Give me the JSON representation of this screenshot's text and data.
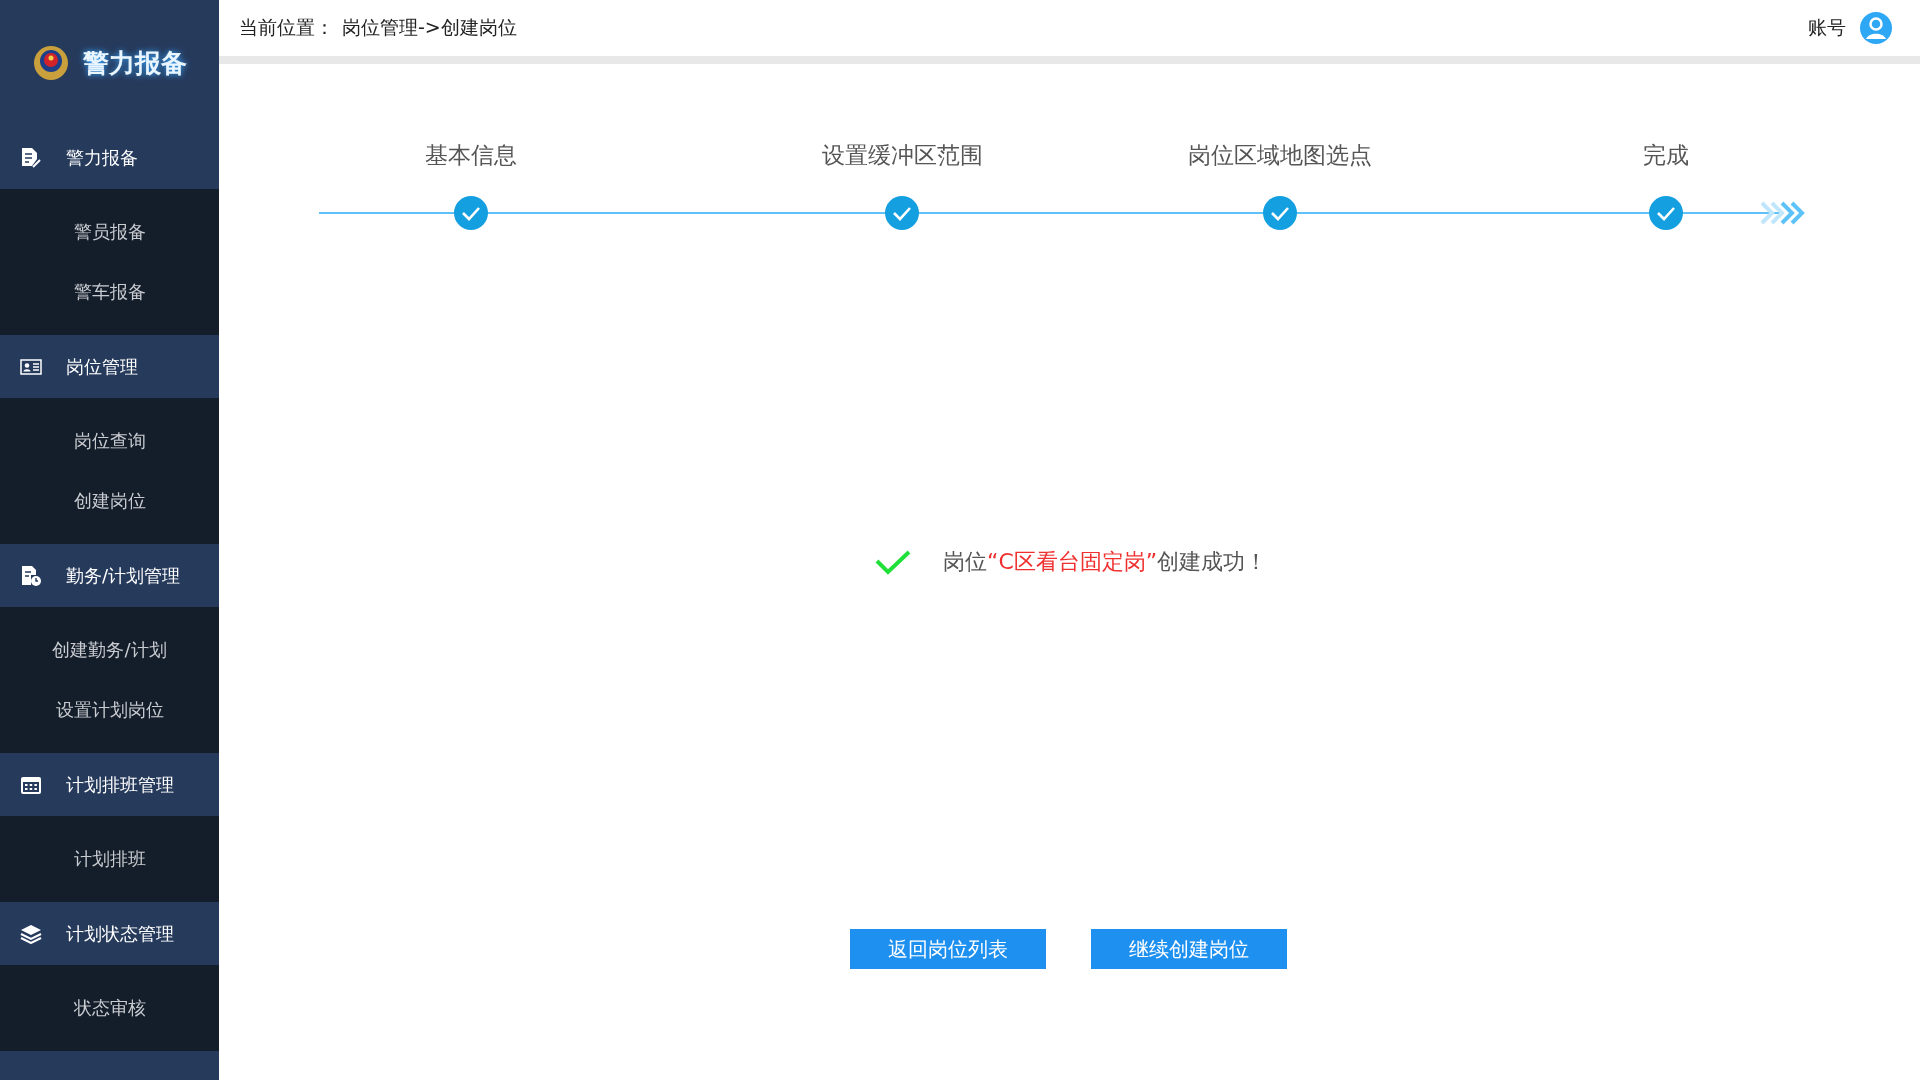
{
  "sidebar": {
    "logo_text": "警力报备",
    "groups": [
      {
        "label": "警力报备",
        "items": [
          "警员报备",
          "警车报备"
        ]
      },
      {
        "label": "岗位管理",
        "items": [
          "岗位查询",
          "创建岗位"
        ]
      },
      {
        "label": "勤务/计划管理",
        "items": [
          "创建勤务/计划",
          "设置计划岗位"
        ]
      },
      {
        "label": "计划排班管理",
        "items": [
          "计划排班"
        ]
      },
      {
        "label": "计划状态管理",
        "items": [
          "状态审核"
        ]
      }
    ]
  },
  "header": {
    "breadcrumb_label": "当前位置：",
    "breadcrumb": "岗位管理->创建岗位",
    "account": "账号"
  },
  "steps": [
    {
      "label": "基本信息",
      "completed": true
    },
    {
      "label": "设置缓冲区范围",
      "completed": true
    },
    {
      "label": "岗位区域地图选点",
      "completed": true
    },
    {
      "label": "完成",
      "completed": true
    }
  ],
  "message": {
    "before": "岗位",
    "highlight": "“C区看台固定岗”",
    "after": "创建成功！"
  },
  "buttons": [
    "返回岗位列表",
    "继续创建岗位"
  ]
}
